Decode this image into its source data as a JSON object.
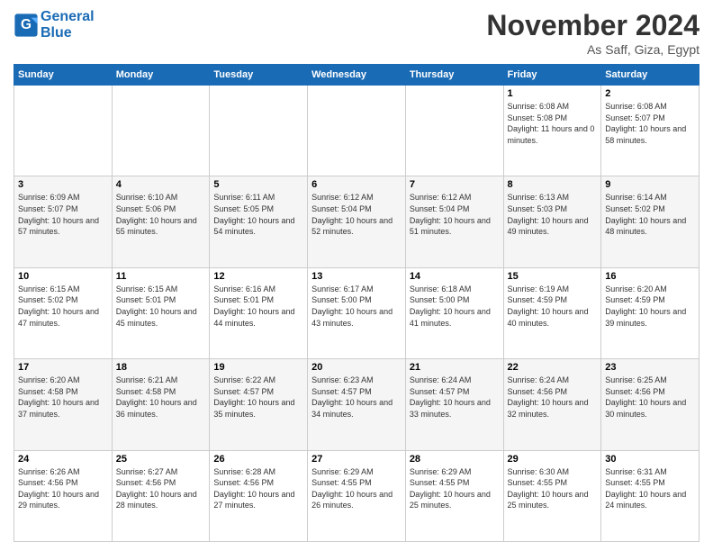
{
  "header": {
    "logo_line1": "General",
    "logo_line2": "Blue",
    "month": "November 2024",
    "location": "As Saff, Giza, Egypt"
  },
  "weekdays": [
    "Sunday",
    "Monday",
    "Tuesday",
    "Wednesday",
    "Thursday",
    "Friday",
    "Saturday"
  ],
  "weeks": [
    [
      {
        "day": "",
        "info": ""
      },
      {
        "day": "",
        "info": ""
      },
      {
        "day": "",
        "info": ""
      },
      {
        "day": "",
        "info": ""
      },
      {
        "day": "",
        "info": ""
      },
      {
        "day": "1",
        "info": "Sunrise: 6:08 AM\nSunset: 5:08 PM\nDaylight: 11 hours and 0 minutes."
      },
      {
        "day": "2",
        "info": "Sunrise: 6:08 AM\nSunset: 5:07 PM\nDaylight: 10 hours and 58 minutes."
      }
    ],
    [
      {
        "day": "3",
        "info": "Sunrise: 6:09 AM\nSunset: 5:07 PM\nDaylight: 10 hours and 57 minutes."
      },
      {
        "day": "4",
        "info": "Sunrise: 6:10 AM\nSunset: 5:06 PM\nDaylight: 10 hours and 55 minutes."
      },
      {
        "day": "5",
        "info": "Sunrise: 6:11 AM\nSunset: 5:05 PM\nDaylight: 10 hours and 54 minutes."
      },
      {
        "day": "6",
        "info": "Sunrise: 6:12 AM\nSunset: 5:04 PM\nDaylight: 10 hours and 52 minutes."
      },
      {
        "day": "7",
        "info": "Sunrise: 6:12 AM\nSunset: 5:04 PM\nDaylight: 10 hours and 51 minutes."
      },
      {
        "day": "8",
        "info": "Sunrise: 6:13 AM\nSunset: 5:03 PM\nDaylight: 10 hours and 49 minutes."
      },
      {
        "day": "9",
        "info": "Sunrise: 6:14 AM\nSunset: 5:02 PM\nDaylight: 10 hours and 48 minutes."
      }
    ],
    [
      {
        "day": "10",
        "info": "Sunrise: 6:15 AM\nSunset: 5:02 PM\nDaylight: 10 hours and 47 minutes."
      },
      {
        "day": "11",
        "info": "Sunrise: 6:15 AM\nSunset: 5:01 PM\nDaylight: 10 hours and 45 minutes."
      },
      {
        "day": "12",
        "info": "Sunrise: 6:16 AM\nSunset: 5:01 PM\nDaylight: 10 hours and 44 minutes."
      },
      {
        "day": "13",
        "info": "Sunrise: 6:17 AM\nSunset: 5:00 PM\nDaylight: 10 hours and 43 minutes."
      },
      {
        "day": "14",
        "info": "Sunrise: 6:18 AM\nSunset: 5:00 PM\nDaylight: 10 hours and 41 minutes."
      },
      {
        "day": "15",
        "info": "Sunrise: 6:19 AM\nSunset: 4:59 PM\nDaylight: 10 hours and 40 minutes."
      },
      {
        "day": "16",
        "info": "Sunrise: 6:20 AM\nSunset: 4:59 PM\nDaylight: 10 hours and 39 minutes."
      }
    ],
    [
      {
        "day": "17",
        "info": "Sunrise: 6:20 AM\nSunset: 4:58 PM\nDaylight: 10 hours and 37 minutes."
      },
      {
        "day": "18",
        "info": "Sunrise: 6:21 AM\nSunset: 4:58 PM\nDaylight: 10 hours and 36 minutes."
      },
      {
        "day": "19",
        "info": "Sunrise: 6:22 AM\nSunset: 4:57 PM\nDaylight: 10 hours and 35 minutes."
      },
      {
        "day": "20",
        "info": "Sunrise: 6:23 AM\nSunset: 4:57 PM\nDaylight: 10 hours and 34 minutes."
      },
      {
        "day": "21",
        "info": "Sunrise: 6:24 AM\nSunset: 4:57 PM\nDaylight: 10 hours and 33 minutes."
      },
      {
        "day": "22",
        "info": "Sunrise: 6:24 AM\nSunset: 4:56 PM\nDaylight: 10 hours and 32 minutes."
      },
      {
        "day": "23",
        "info": "Sunrise: 6:25 AM\nSunset: 4:56 PM\nDaylight: 10 hours and 30 minutes."
      }
    ],
    [
      {
        "day": "24",
        "info": "Sunrise: 6:26 AM\nSunset: 4:56 PM\nDaylight: 10 hours and 29 minutes."
      },
      {
        "day": "25",
        "info": "Sunrise: 6:27 AM\nSunset: 4:56 PM\nDaylight: 10 hours and 28 minutes."
      },
      {
        "day": "26",
        "info": "Sunrise: 6:28 AM\nSunset: 4:56 PM\nDaylight: 10 hours and 27 minutes."
      },
      {
        "day": "27",
        "info": "Sunrise: 6:29 AM\nSunset: 4:55 PM\nDaylight: 10 hours and 26 minutes."
      },
      {
        "day": "28",
        "info": "Sunrise: 6:29 AM\nSunset: 4:55 PM\nDaylight: 10 hours and 25 minutes."
      },
      {
        "day": "29",
        "info": "Sunrise: 6:30 AM\nSunset: 4:55 PM\nDaylight: 10 hours and 25 minutes."
      },
      {
        "day": "30",
        "info": "Sunrise: 6:31 AM\nSunset: 4:55 PM\nDaylight: 10 hours and 24 minutes."
      }
    ]
  ]
}
